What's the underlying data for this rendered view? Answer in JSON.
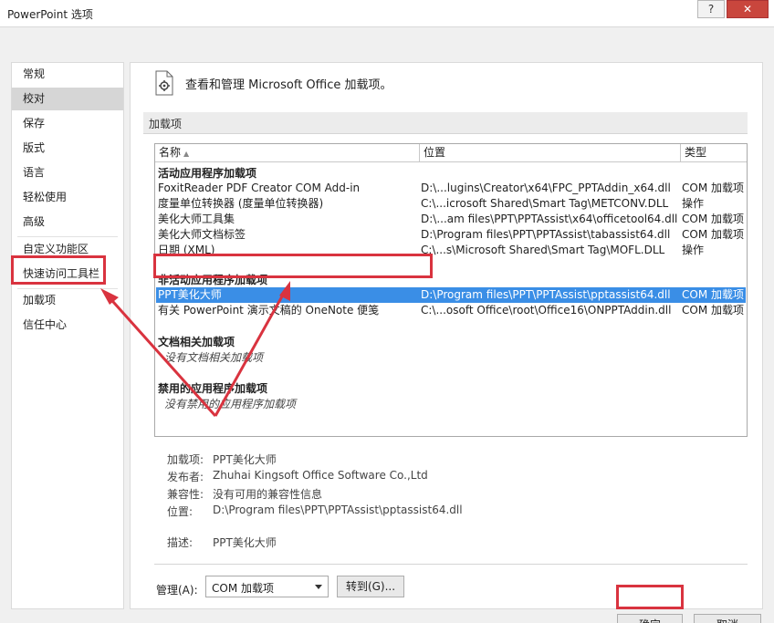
{
  "window": {
    "title": "PowerPoint 选项",
    "help_label": "?",
    "close_label": "✕"
  },
  "nav": {
    "items": [
      {
        "label": "常规"
      },
      {
        "label": "校对"
      },
      {
        "label": "保存"
      },
      {
        "label": "版式"
      },
      {
        "label": "语言"
      },
      {
        "label": "轻松使用"
      },
      {
        "label": "高级"
      },
      {
        "label": "自定义功能区"
      },
      {
        "label": "快速访问工具栏"
      },
      {
        "label": "加载项"
      },
      {
        "label": "信任中心"
      }
    ],
    "selected": "加载项"
  },
  "header": {
    "icon": "addins-gear-icon",
    "title": "查看和管理 Microsoft Office 加载项。"
  },
  "section": {
    "title": "加载项"
  },
  "table": {
    "columns": {
      "name": "名称",
      "location": "位置",
      "type": "类型"
    },
    "groups": {
      "active": "活动应用程序加载项",
      "inactive": "非活动应用程序加载项",
      "document": "文档相关加载项",
      "disabled": "禁用的应用程序加载项"
    },
    "active_rows": [
      {
        "name": "FoxitReader PDF Creator COM Add-in",
        "location": "D:\\...lugins\\Creator\\x64\\FPC_PPTAddin_x64.dll",
        "type": "COM 加载项"
      },
      {
        "name": "度量单位转换器 (度量单位转换器)",
        "location": "C:\\...icrosoft Shared\\Smart Tag\\METCONV.DLL",
        "type": "操作"
      },
      {
        "name": "美化大师工具集",
        "location": "D:\\...am files\\PPT\\PPTAssist\\x64\\officetool64.dll",
        "type": "COM 加载项"
      },
      {
        "name": "美化大师文档标签",
        "location": "D:\\Program files\\PPT\\PPTAssist\\tabassist64.dll",
        "type": "COM 加载项"
      },
      {
        "name": "日期 (XML)",
        "location": "C:\\...s\\Microsoft Shared\\Smart Tag\\MOFL.DLL",
        "type": "操作"
      }
    ],
    "inactive_rows": [
      {
        "name": "PPT美化大师",
        "location": "D:\\Program files\\PPT\\PPTAssist\\pptassist64.dll",
        "type": "COM 加载项"
      },
      {
        "name": "有关 PowerPoint 演示文稿的 OneNote 便笺",
        "location": "C:\\...osoft Office\\root\\Office16\\ONPPTAddin.dll",
        "type": "COM 加载项"
      }
    ],
    "document_note": "没有文档相关加载项",
    "disabled_note": "没有禁用的应用程序加载项"
  },
  "details": {
    "addin_label": "加载项:",
    "addin_value": "PPT美化大师",
    "publisher_label": "发布者:",
    "publisher_value": "Zhuhai Kingsoft Office Software Co.,Ltd",
    "compat_label": "兼容性:",
    "compat_value": "没有可用的兼容性信息",
    "location_label": "位置:",
    "location_value": "D:\\Program files\\PPT\\PPTAssist\\pptassist64.dll",
    "desc_label": "描述:",
    "desc_value": "PPT美化大师"
  },
  "manage": {
    "label": "管理(A):",
    "selected": "COM 加载项",
    "goto_label": "转到(G)..."
  },
  "footer": {
    "ok_label": "确定",
    "cancel_label": "取消"
  },
  "colors": {
    "selection": "#3a8ee6",
    "annotation": "#d9333f",
    "nav_selected": "#d6d6d6"
  }
}
